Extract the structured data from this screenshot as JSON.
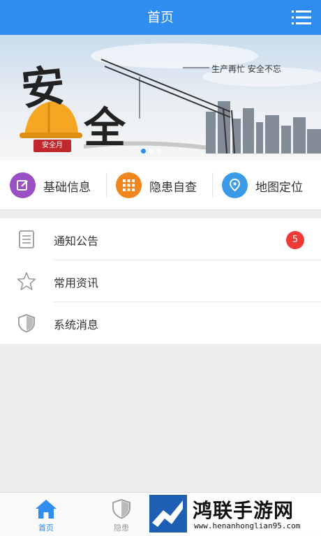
{
  "header": {
    "title": "首页",
    "menu_icon": "list-menu-icon"
  },
  "banner": {
    "slogan": "生产再忙  安全不忘",
    "calligraphy_1": "安",
    "calligraphy_2": "全",
    "stamp": "安全月",
    "slides_total": 3,
    "active_slide": 1
  },
  "quick_actions": [
    {
      "label": "基础信息",
      "icon": "edit-icon",
      "color": "#9b4fc4"
    },
    {
      "label": "隐患自查",
      "icon": "grid-icon",
      "color": "#f0861c"
    },
    {
      "label": "地图定位",
      "icon": "location-icon",
      "color": "#3a9ae8"
    }
  ],
  "list": [
    {
      "label": "通知公告",
      "icon": "notice-document-icon",
      "badge": "5"
    },
    {
      "label": "常用资讯",
      "icon": "star-icon",
      "badge": null
    },
    {
      "label": "系统消息",
      "icon": "shield-icon",
      "badge": null
    }
  ],
  "tabbar": [
    {
      "label": "首页",
      "icon": "home-icon",
      "active": true,
      "color": "#2f8cf0"
    },
    {
      "label": "隐患",
      "icon": "shield-icon",
      "active": false,
      "color": "#999999"
    }
  ],
  "watermark": {
    "title": "鸿联手游网",
    "url": "www.henanhonglian95.com"
  },
  "colors": {
    "primary": "#2f8cf0",
    "badge": "#f03a35",
    "background": "#ededf0"
  }
}
